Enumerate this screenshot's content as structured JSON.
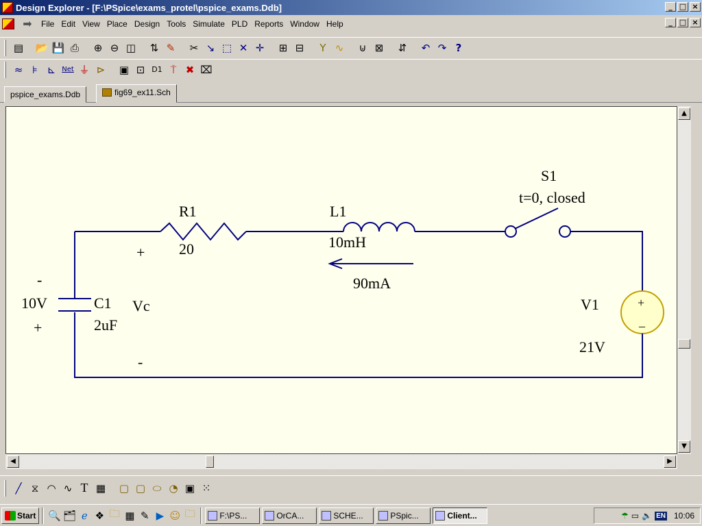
{
  "window": {
    "title": "Design Explorer - [F:\\PSpice\\exams_protel\\pspice_exams.Ddb]",
    "controls": [
      "_",
      "□",
      "×"
    ]
  },
  "menu": [
    "File",
    "Edit",
    "View",
    "Place",
    "Design",
    "Tools",
    "Simulate",
    "PLD",
    "Reports",
    "Window",
    "Help"
  ],
  "tabs": [
    {
      "label": "pspice_exams.Ddb"
    },
    {
      "label": "fig69_ex11.Sch"
    }
  ],
  "schematic": {
    "r1": {
      "name": "R1",
      "value": "20"
    },
    "l1": {
      "name": "L1",
      "value": "10mH"
    },
    "current_label": "90mA",
    "s1": {
      "name": "S1",
      "state": "t=0, closed"
    },
    "c1": {
      "name": "C1",
      "value": "2uF",
      "voltage": "10V",
      "minus": "-",
      "plus": "+"
    },
    "vc": {
      "label": "Vc",
      "plus": "+",
      "minus": "-"
    },
    "v1": {
      "name": "V1",
      "value": "21V",
      "plus": "+",
      "minus": "–"
    },
    "wire_color": "#000080"
  },
  "taskbar": {
    "start": "Start",
    "tasks": [
      "F:\\PS...",
      "OrCA...",
      "SCHE...",
      "PSpic...",
      "Client..."
    ],
    "active_task": "Client...",
    "lang": "EN",
    "clock": "10:06"
  }
}
